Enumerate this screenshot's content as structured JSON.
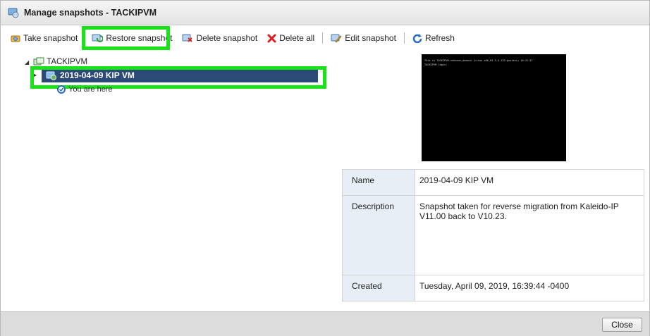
{
  "window": {
    "title": "Manage snapshots - TACKIPVM"
  },
  "toolbar": {
    "take_snapshot": "Take snapshot",
    "restore_snapshot": "Restore snapshot",
    "delete_snapshot": "Delete snapshot",
    "delete_all": "Delete all",
    "edit_snapshot": "Edit snapshot",
    "refresh": "Refresh"
  },
  "tree": {
    "root_label": "TACKIPVM",
    "snapshot_label": "2019-04-09 KIP VM",
    "current_label": "You are here"
  },
  "console": {
    "line1": "This is TACKIPVM.unknown_domain (Linux x86_64 5.4.129-gnutest) 16:41:37",
    "line2": "TACKIPVM login:"
  },
  "details": {
    "name_key": "Name",
    "name_value": "2019-04-09 KIP VM",
    "description_key": "Description",
    "description_value": "Snapshot taken for reverse migration from Kaleido-IP V11.00 back to V10.23.",
    "created_key": "Created",
    "created_value": "Tuesday, April 09, 2019, 16:39:44 -0400"
  },
  "footer": {
    "close_label": "Close"
  },
  "colors": {
    "selection": "#2c4a78",
    "highlight": "#19e219",
    "key_cell_bg": "#e7eef5"
  }
}
